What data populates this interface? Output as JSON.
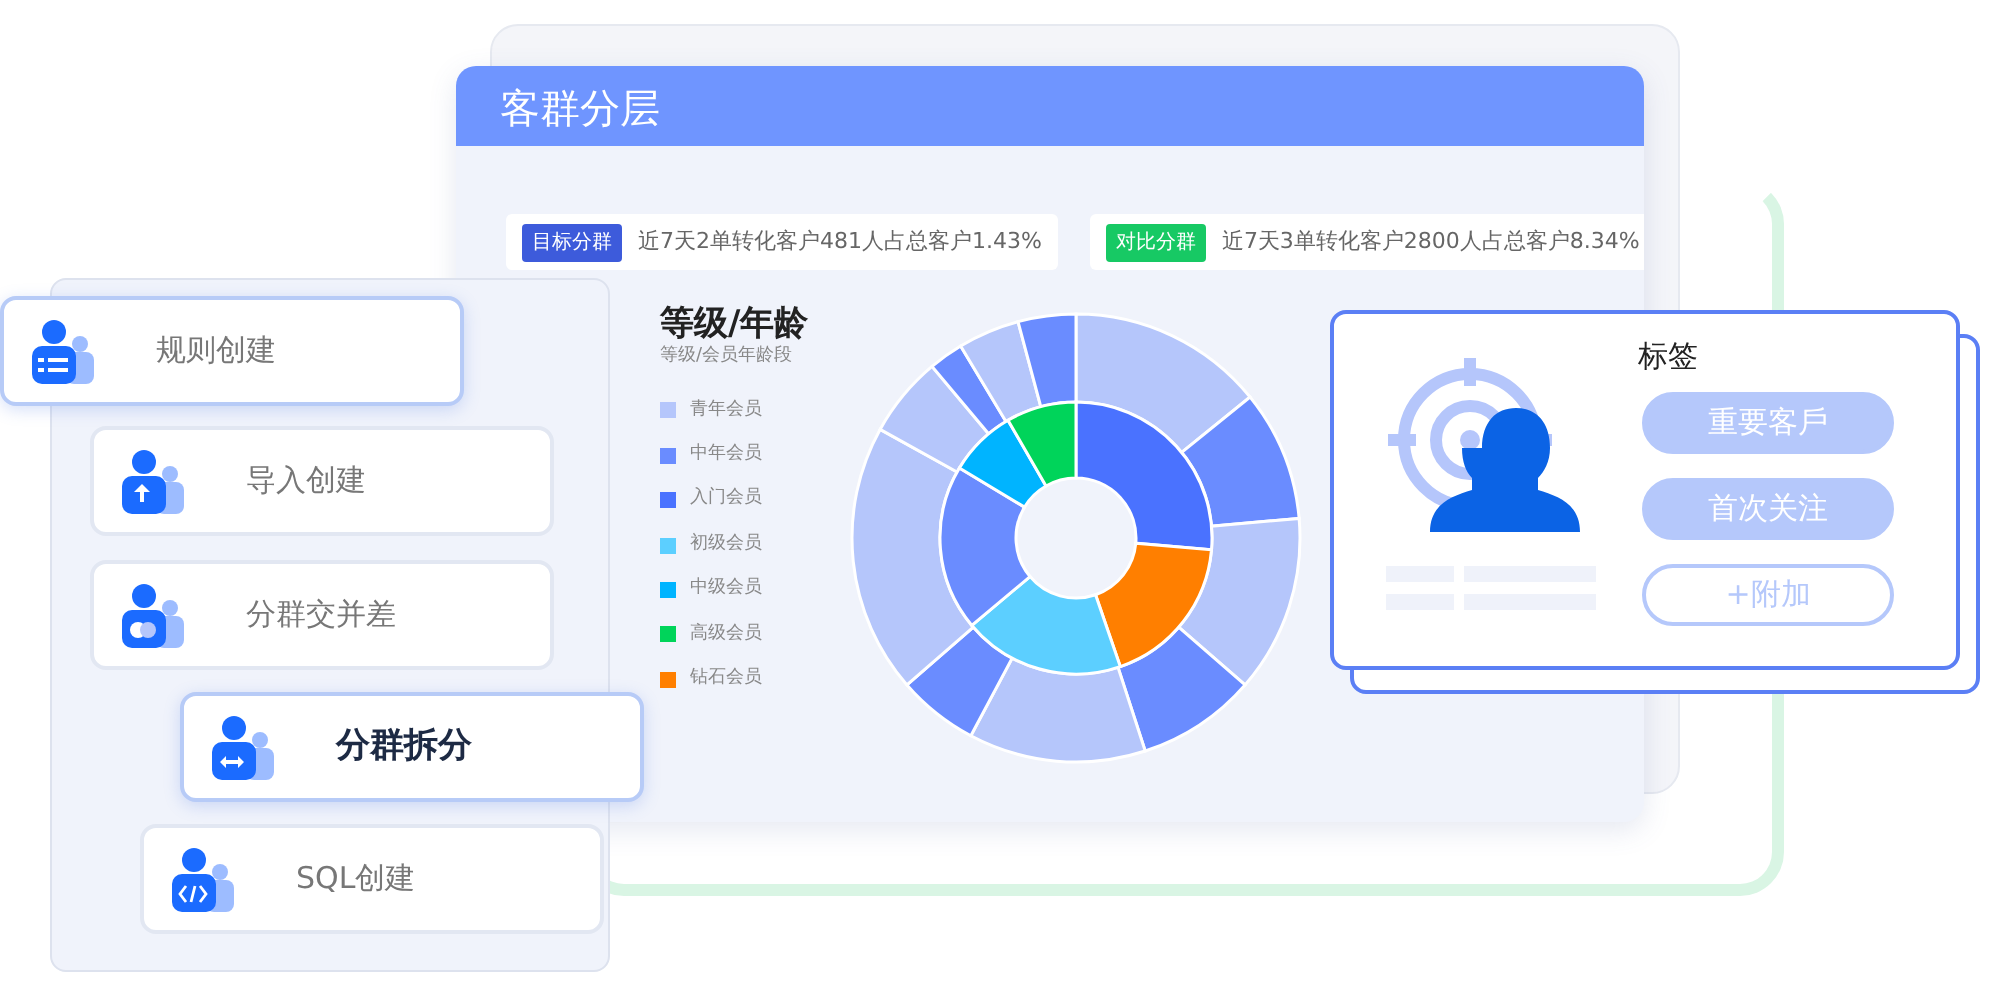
{
  "panel": {
    "title": "客群分层"
  },
  "stats": [
    {
      "badge": "目标分群",
      "text": "近7天2单转化客户481人占总客户1.43%",
      "color": "#3d5bdb"
    },
    {
      "badge": "对比分群",
      "text": "近7天3单转化客户2800人占总客户8.34%",
      "color": "#17c964"
    }
  ],
  "legend": {
    "title": "等级/年龄",
    "subtitle": "等级/会员年龄段",
    "items": [
      {
        "label": "青年会员",
        "color": "#b5c6fb"
      },
      {
        "label": "中年会员",
        "color": "#6a8cff"
      },
      {
        "label": "入门会员",
        "color": "#4a72ff"
      },
      {
        "label": "初级会员",
        "color": "#5ccfff"
      },
      {
        "label": "中级会员",
        "color": "#00b4ff"
      },
      {
        "label": "高级会员",
        "color": "#00d45a"
      },
      {
        "label": "钻石会员",
        "color": "#ff7f00"
      }
    ]
  },
  "tag_card": {
    "title": "标签",
    "tags": [
      {
        "label": "重要客戶",
        "kind": "filled"
      },
      {
        "label": "首次关注",
        "kind": "filled"
      },
      {
        "label": "+附加",
        "kind": "outline"
      }
    ]
  },
  "methods": [
    {
      "label": "规则创建",
      "kind": "list",
      "highlighted": true,
      "selected": false
    },
    {
      "label": "导入创建",
      "kind": "upload",
      "highlighted": false,
      "selected": false
    },
    {
      "label": "分群交并差",
      "kind": "merge",
      "highlighted": false,
      "selected": false
    },
    {
      "label": "分群拆分",
      "kind": "split",
      "highlighted": true,
      "selected": true
    },
    {
      "label": "SQL创建",
      "kind": "code",
      "highlighted": false,
      "selected": false
    }
  ]
}
